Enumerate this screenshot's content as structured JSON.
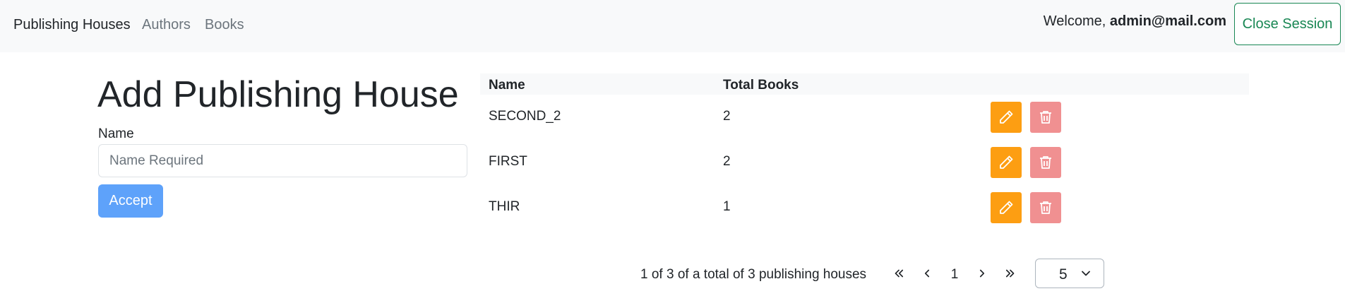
{
  "navbar": {
    "brand": "Publishing Houses",
    "links": [
      "Authors",
      "Books"
    ],
    "welcome_prefix": "Welcome,",
    "user_email": "admin@mail.com",
    "close_session_label": "Close Session"
  },
  "form": {
    "title": "Add Publishing House",
    "name_label": "Name",
    "name_placeholder": "Name Required",
    "name_value": "",
    "accept_label": "Accept"
  },
  "table": {
    "columns": [
      "Name",
      "Total Books",
      ""
    ],
    "rows": [
      {
        "name": "SECOND_2",
        "total_books": "2"
      },
      {
        "name": "FIRST",
        "total_books": "2"
      },
      {
        "name": "THIR",
        "total_books": "1"
      }
    ]
  },
  "pagination": {
    "info": "1 of 3 of a total of 3 publishing houses",
    "current_page": "1",
    "page_size": "5",
    "icons": [
      "double-chevron-left-icon",
      "chevron-left-icon",
      "chevron-right-icon",
      "double-chevron-right-icon"
    ]
  },
  "colors": {
    "edit_button": "#fd9e12",
    "delete_button": "#f09091",
    "accept_button": "#5ea2fa",
    "close_session": "#198754",
    "navbar_bg": "#f8f9fa"
  }
}
